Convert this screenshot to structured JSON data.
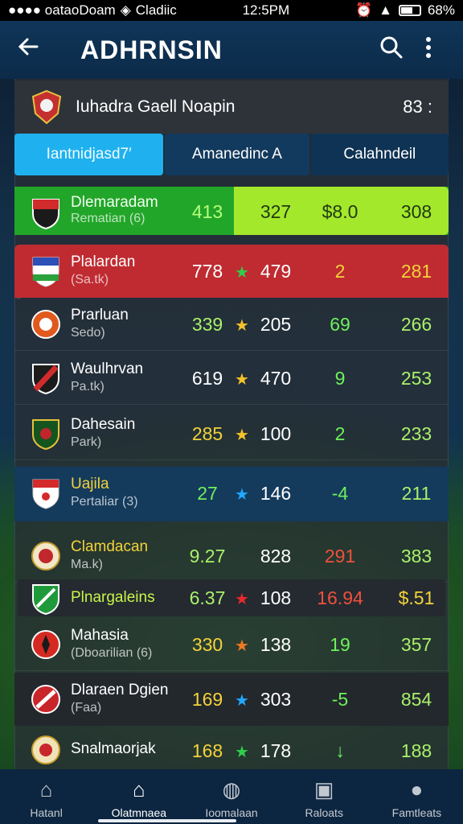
{
  "status_bar": {
    "left": "●●●● oataoDoam",
    "carrier": "Cladiic",
    "time": "12:5PM",
    "battery": "68%"
  },
  "app_bar": {
    "title": "ADHRNSIN"
  },
  "league": {
    "name": "Iuhadra Gaell Noapin",
    "extra": "83 :"
  },
  "tabs": [
    {
      "label": "Iantnidjasd7′"
    },
    {
      "label": "Amanedinc A"
    },
    {
      "label": "Calahndeil"
    }
  ],
  "highlight_row": {
    "name": "Dlemaradam",
    "sub": "Rematian (6)",
    "c1": "413",
    "c2": "327",
    "c3": "$8.0",
    "c4": "308"
  },
  "rows": [
    {
      "name": "Plalardan",
      "sub": "(Sa.tk)",
      "c1": "778",
      "star": "★",
      "c2": "479",
      "c3": "2",
      "c4": "281"
    },
    {
      "name": "Prarluan",
      "sub": "Sedo)",
      "c1": "339",
      "star": "★",
      "c2": "205",
      "c3": "69",
      "c4": "266"
    },
    {
      "name": "Waulhrvan",
      "sub": "Pa.tk)",
      "c1": "619",
      "star": "★",
      "c2": "470",
      "c3": "9",
      "c4": "253"
    },
    {
      "name": "Dahesain",
      "sub": "Park)",
      "c1": "285",
      "star": "★",
      "c2": "100",
      "c3": "2",
      "c4": "233"
    },
    {
      "name": "Uajila",
      "sub": "Pertaliar (3)",
      "c1": "27",
      "star": "★",
      "c2": "146",
      "c3": "-4",
      "c4": "211"
    },
    {
      "name": "Clamdacan",
      "sub": "Ma.k)",
      "c1": "9.27",
      "c2": "828",
      "c3": "291",
      "c4": "383"
    },
    {
      "name": "Plnargaleins",
      "c1": "6.37",
      "star": "★",
      "c2": "108",
      "c3": "16.94",
      "c4": "$.51"
    },
    {
      "name": "Mahasia",
      "sub": "(Dboarilian (6)",
      "c1": "330",
      "star": "★",
      "c2": "138",
      "c3": "19",
      "c4": "357"
    },
    {
      "name": "Dlaraen Dgien",
      "sub": "(Faa)",
      "c1": "169",
      "star": "★",
      "c2": "303",
      "c3": "-5",
      "c4": "854"
    },
    {
      "name": "Snalmaorjak",
      "c1": "168",
      "star": "★",
      "c2": "178",
      "c3": "↓",
      "c4": "188"
    }
  ],
  "nav": [
    {
      "label": "Hatanl"
    },
    {
      "label": "Olatmnaea"
    },
    {
      "label": "Ioomalaan"
    },
    {
      "label": "Raloats"
    },
    {
      "label": "Famtleats"
    }
  ],
  "colors": {
    "highlight_green": "#22a629",
    "lime": "#a4e82c",
    "red_row": "#bf2b31",
    "blue_row": "#143a5c",
    "tab_active": "#1fb1ef",
    "app_bar": "#0f3558"
  },
  "icons": {
    "back": "arrow-left-icon",
    "search": "search-icon",
    "menu": "more-vertical-icon"
  }
}
